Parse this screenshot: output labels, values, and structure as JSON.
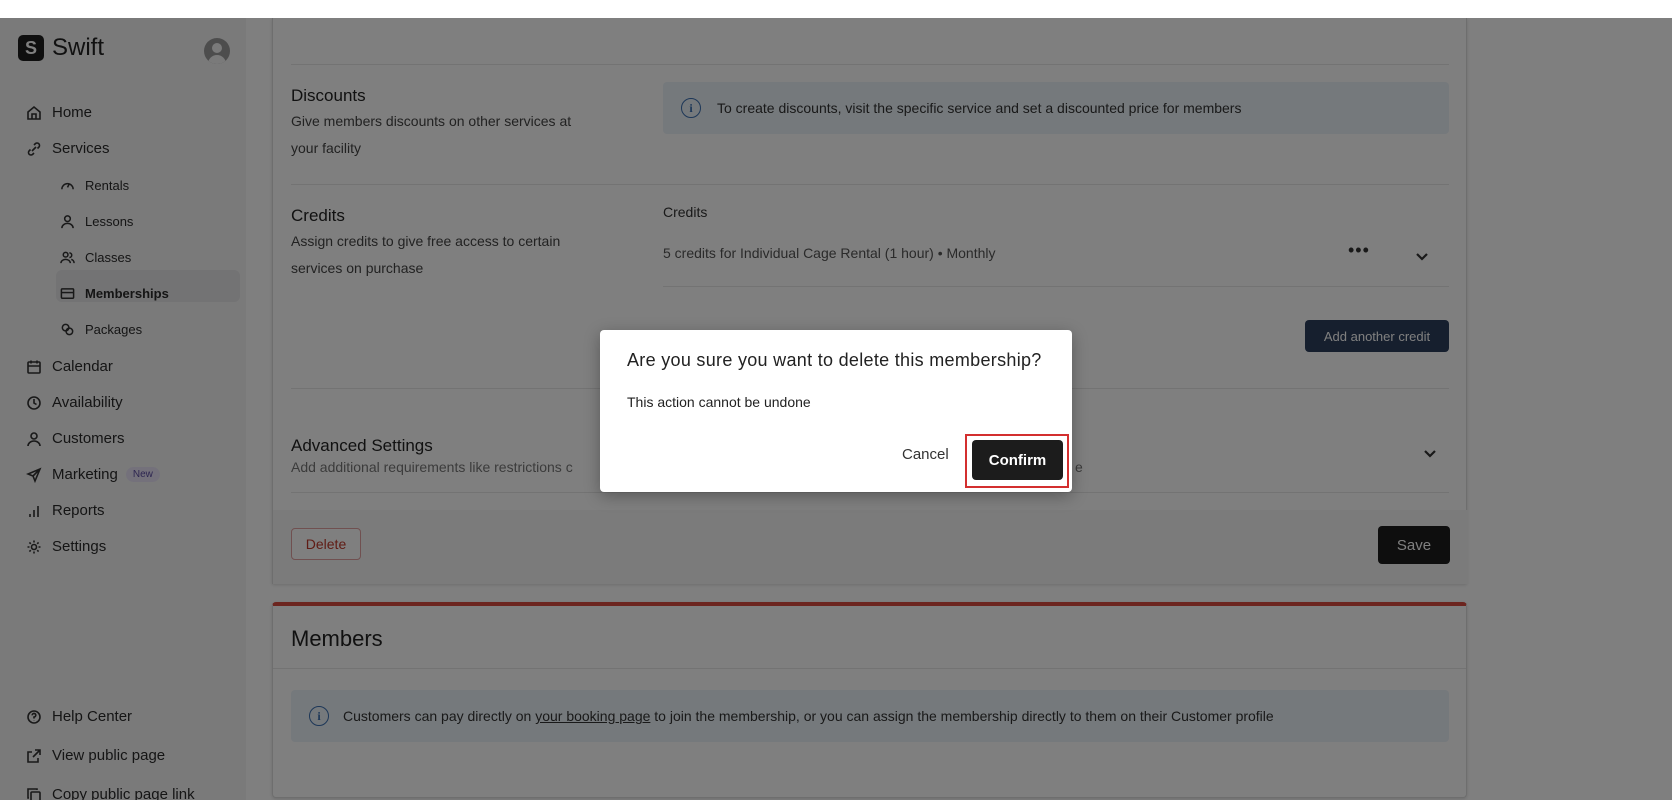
{
  "brand": {
    "name": "Swift",
    "logo_letter": "S"
  },
  "sidebar": {
    "items": [
      {
        "label": "Home",
        "icon": "home-icon"
      },
      {
        "label": "Services",
        "icon": "link-icon"
      },
      {
        "label": "Calendar",
        "icon": "calendar-icon"
      },
      {
        "label": "Availability",
        "icon": "clock-icon"
      },
      {
        "label": "Customers",
        "icon": "user-icon"
      },
      {
        "label": "Marketing",
        "icon": "send-icon",
        "badge": "New"
      },
      {
        "label": "Reports",
        "icon": "bar-chart-icon"
      },
      {
        "label": "Settings",
        "icon": "gear-icon"
      }
    ],
    "sub_items": [
      {
        "label": "Rentals",
        "icon": "gauge-icon"
      },
      {
        "label": "Lessons",
        "icon": "person-icon"
      },
      {
        "label": "Classes",
        "icon": "users-icon"
      },
      {
        "label": "Memberships",
        "icon": "card-icon",
        "active": true
      },
      {
        "label": "Packages",
        "icon": "packages-icon"
      }
    ],
    "bottom": [
      {
        "label": "Help Center",
        "icon": "help-icon"
      },
      {
        "label": "View public page",
        "icon": "external-link-icon"
      },
      {
        "label": "Copy public page link",
        "icon": "copy-icon"
      }
    ]
  },
  "form": {
    "discounts": {
      "title": "Discounts",
      "desc": "Give members discounts on other services at your facility",
      "info": "To create discounts, visit the specific service and set a discounted price for members"
    },
    "credits": {
      "title": "Credits",
      "desc": "Assign credits to give free access to certain services on purchase",
      "label": "Credits",
      "row": "5 credits for Individual Cage Rental (1 hour) • Monthly",
      "more": "•••",
      "add_button": "Add another credit"
    },
    "advanced": {
      "title": "Advanced Settings",
      "desc": "Add additional requirements like restrictions c",
      "trailing": "e"
    },
    "delete_button": "Delete",
    "save_button": "Save"
  },
  "members": {
    "title": "Members",
    "info_prefix": "Customers can pay directly on ",
    "info_link": "your booking page",
    "info_suffix": " to join the membership, or you can assign the membership directly to them on their Customer profile"
  },
  "modal": {
    "title": "Are you sure you want to delete this membership?",
    "body": "This action cannot be undone",
    "cancel": "Cancel",
    "confirm": "Confirm"
  },
  "colors": {
    "accent_dark": "#1c1c1c",
    "credit_button": "#2d3e5c",
    "members_border": "#d94b3f",
    "highlight": "#d32f2f",
    "info_bg": "#eaf2f8"
  }
}
